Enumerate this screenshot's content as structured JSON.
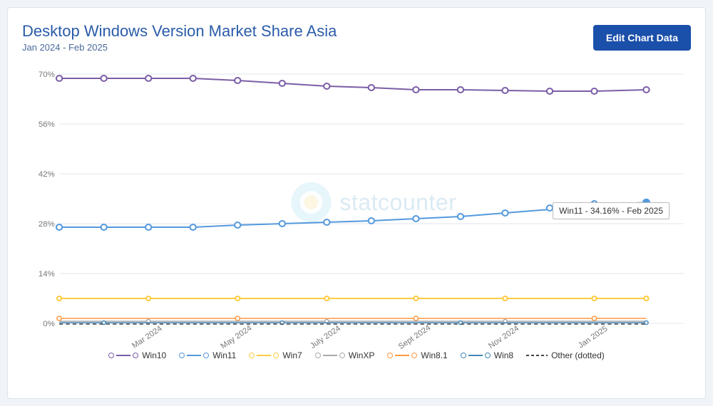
{
  "header": {
    "title": "Desktop Windows Version Market Share Asia",
    "subtitle": "Jan 2024 - Feb 2025",
    "edit_button_label": "Edit Chart Data"
  },
  "chart": {
    "y_axis_labels": [
      "70%",
      "56%",
      "42%",
      "28%",
      "14%",
      "0%"
    ],
    "x_axis_labels": [
      "Mar 2024",
      "May 2024",
      "July 2024",
      "Sept 2024",
      "Nov 2024",
      "Jan 2025"
    ],
    "tooltip": {
      "text": "Win11 - 34.16% - Feb 2025",
      "visible": true
    },
    "watermark": {
      "text": "statcounter"
    }
  },
  "legend": {
    "items": [
      {
        "label": "Win10",
        "color": "#7b5ea7",
        "type": "circle-line"
      },
      {
        "label": "Win11",
        "color": "#5599dd",
        "type": "circle-line"
      },
      {
        "label": "Win7",
        "color": "#ffcc44",
        "type": "circle-line"
      },
      {
        "label": "WinXP",
        "color": "#aaaaaa",
        "type": "circle-line"
      },
      {
        "label": "Win8.1",
        "color": "#ff9944",
        "type": "circle-line"
      },
      {
        "label": "Win8",
        "color": "#4488bb",
        "type": "circle-line"
      },
      {
        "label": "Other (dotted)",
        "color": "#444444",
        "type": "dash-line"
      }
    ]
  },
  "colors": {
    "accent": "#1a4faa",
    "win10": "#7b5ea7",
    "win11": "#5599dd",
    "win7": "#ffcc44",
    "winxp": "#aaaaaa",
    "win8_1": "#ff9944",
    "win8": "#4488bb",
    "other": "#444444",
    "grid": "#e8edf2"
  }
}
